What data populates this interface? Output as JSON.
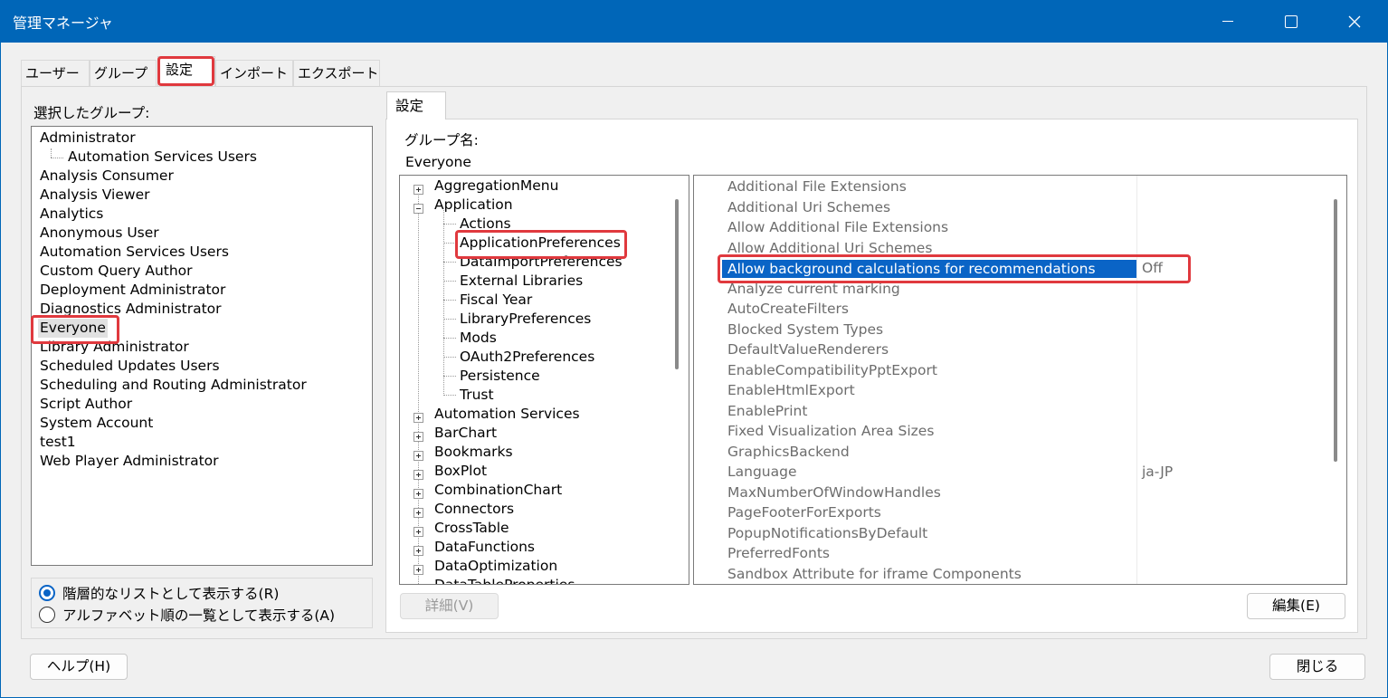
{
  "window": {
    "title": "管理マネージャ"
  },
  "tabs": [
    "ユーザー",
    "グループ",
    "設定",
    "インポート",
    "エクスポート"
  ],
  "left": {
    "label": "選択したグループ:",
    "groups": [
      "Administrator",
      "Automation Services Users",
      "Analysis Consumer",
      "Analysis Viewer",
      "Analytics",
      "Anonymous User",
      "Automation Services Users",
      "Custom Query Author",
      "Deployment Administrator",
      "Diagnostics Administrator",
      "Everyone",
      "Library Administrator",
      "Scheduled Updates Users",
      "Scheduling and Routing Administrator",
      "Script Author",
      "System Account",
      "test1",
      "Web Player Administrator"
    ],
    "selected": "Everyone",
    "radio_hierarchical": "階層的なリストとして表示する(R)",
    "radio_alphabetical": "アルファベット順の一覧として表示する(A)"
  },
  "settings": {
    "tab_label": "設定",
    "group_name_label": "グループ名:",
    "group_name_value": "Everyone",
    "tree": {
      "n0": "AggregationMenu",
      "n1": "Application",
      "c0": "Actions",
      "c1": "ApplicationPreferences",
      "c2": "DataImportPreferences",
      "c3": "External Libraries",
      "c4": "Fiscal Year",
      "c5": "LibraryPreferences",
      "c6": "Mods",
      "c7": "OAuth2Preferences",
      "c8": "Persistence",
      "c9": "Trust",
      "n2": "Automation Services",
      "n3": "BarChart",
      "n4": "Bookmarks",
      "n5": "BoxPlot",
      "n6": "CombinationChart",
      "n7": "Connectors",
      "n8": "CrossTable",
      "n9": "DataFunctions",
      "n10": "DataOptimization",
      "n11": "DataTableProperties"
    },
    "properties": [
      {
        "name": "Additional File Extensions",
        "value": ""
      },
      {
        "name": "Additional Uri Schemes",
        "value": ""
      },
      {
        "name": "Allow Additional File Extensions",
        "value": ""
      },
      {
        "name": "Allow Additional Uri Schemes",
        "value": ""
      },
      {
        "name": "Allow background calculations for recommendations",
        "value": "Off"
      },
      {
        "name": "Analyze current marking",
        "value": ""
      },
      {
        "name": "AutoCreateFilters",
        "value": ""
      },
      {
        "name": "Blocked System Types",
        "value": ""
      },
      {
        "name": "DefaultValueRenderers",
        "value": ""
      },
      {
        "name": "EnableCompatibilityPptExport",
        "value": ""
      },
      {
        "name": "EnableHtmlExport",
        "value": ""
      },
      {
        "name": "EnablePrint",
        "value": ""
      },
      {
        "name": "Fixed Visualization Area Sizes",
        "value": ""
      },
      {
        "name": "GraphicsBackend",
        "value": ""
      },
      {
        "name": "Language",
        "value": "ja-JP"
      },
      {
        "name": "MaxNumberOfWindowHandles",
        "value": ""
      },
      {
        "name": "PageFooterForExports",
        "value": ""
      },
      {
        "name": "PopupNotificationsByDefault",
        "value": ""
      },
      {
        "name": "PreferredFonts",
        "value": ""
      },
      {
        "name": "Sandbox Attribute for iframe Components",
        "value": ""
      }
    ],
    "details_button": "詳細(V)",
    "edit_button": "編集(E)"
  },
  "footer": {
    "help_button": "ヘルプ(H)",
    "close_button": "閉じる"
  },
  "colors": {
    "titlebar": "#0066b8",
    "selection": "#0a64c6",
    "highlight": "#e0393e"
  }
}
